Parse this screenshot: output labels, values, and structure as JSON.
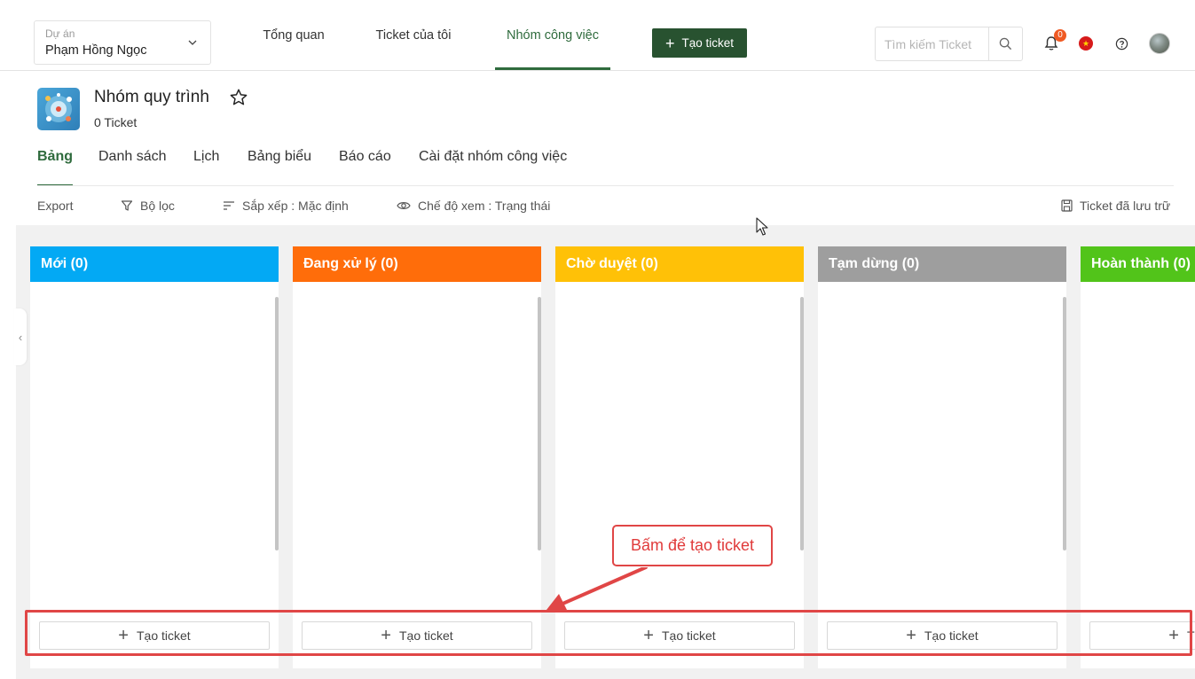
{
  "project": {
    "label": "Dự án",
    "value": "Phạm Hồng Ngọc"
  },
  "topnav": [
    {
      "label": "Tổng quan",
      "active": false
    },
    {
      "label": "Ticket của tôi",
      "active": false
    },
    {
      "label": "Nhóm công việc",
      "active": true
    }
  ],
  "create_button": {
    "label": "Tạo ticket",
    "color": "#285230"
  },
  "search": {
    "placeholder": "Tìm kiếm Ticket"
  },
  "notifications": {
    "count": "0"
  },
  "group": {
    "title": "Nhóm quy trình",
    "count": "0 Ticket"
  },
  "tabs": [
    {
      "label": "Bảng",
      "active": true
    },
    {
      "label": "Danh sách",
      "active": false
    },
    {
      "label": "Lịch",
      "active": false
    },
    {
      "label": "Bảng biểu",
      "active": false
    },
    {
      "label": "Báo cáo",
      "active": false
    },
    {
      "label": "Cài đặt nhóm công việc",
      "active": false
    }
  ],
  "toolbar": {
    "export": "Export",
    "filter": "Bộ lọc",
    "sort": "Sắp xếp : Mặc định",
    "view": "Chế độ xem : Trạng thái",
    "archived": "Ticket đã lưu trữ"
  },
  "columns": [
    {
      "title": "Mới (0)",
      "color": "#03a9f4",
      "add_label": "Tạo ticket"
    },
    {
      "title": "Đang xử lý (0)",
      "color": "#ff6d0a",
      "add_label": "Tạo ticket"
    },
    {
      "title": "Chờ duyệt (0)",
      "color": "#ffc107",
      "add_label": "Tạo ticket"
    },
    {
      "title": "Tạm dừng (0)",
      "color": "#9e9e9e",
      "add_label": "Tạo ticket"
    },
    {
      "title": "Hoàn thành (0)",
      "color": "#52c41a",
      "add_label": "Tạo ticket"
    }
  ],
  "annotation": {
    "text": "Bấm để tạo ticket",
    "color": "#e04646"
  }
}
